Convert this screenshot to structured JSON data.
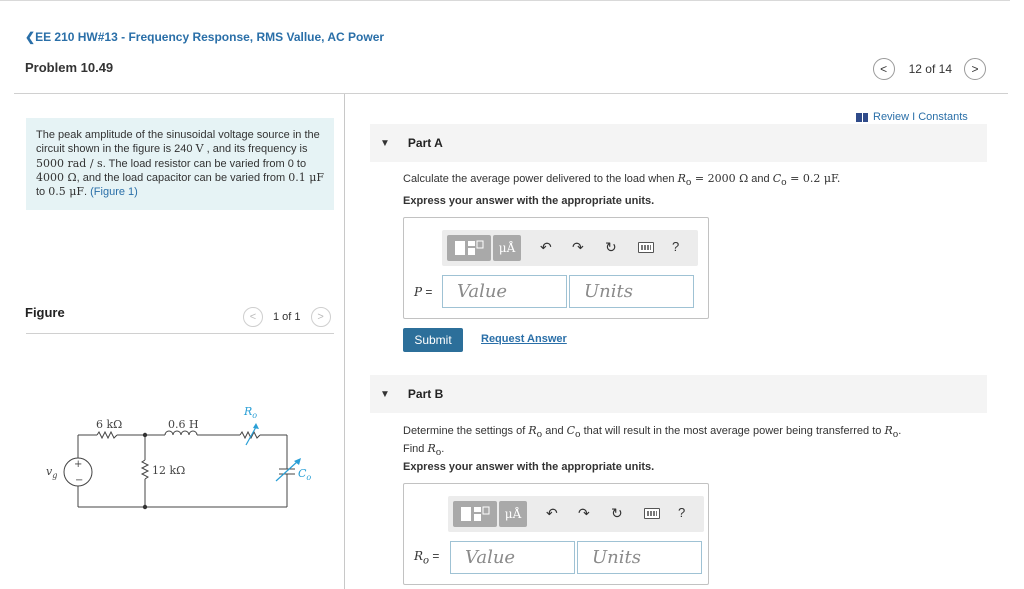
{
  "header": {
    "breadcrumb": "EE 210 HW#13 - Frequency Response, RMS Vallue, AC Power",
    "problem_title": "Problem 10.49",
    "pager_text": "12 of 14"
  },
  "problem": {
    "text_1": "The peak amplitude of the sinusoidal voltage source in the circuit shown in the figure is 240 ",
    "v_unit": "V",
    "text_2": " , and its frequency is ",
    "freq": "5000 rad / s",
    "text_3": ". The load resistor can be varied from 0 to ",
    "r_max": "4000 Ω",
    "text_4": ", and the load capacitor can be varied from ",
    "c_min": "0.1 μF",
    "to_word": " to ",
    "c_max": "0.5 μF",
    "text_5": ". ",
    "figure_link": "(Figure 1)"
  },
  "figure": {
    "label": "Figure",
    "pager_text": "1 of 1",
    "circuit": {
      "r1": "6 kΩ",
      "l1": "0.6 H",
      "ro": "R",
      "ro_sub": "o",
      "r2": "12 kΩ",
      "source": "v",
      "source_sub": "g",
      "co": "C",
      "co_sub": "o",
      "plus": "+",
      "minus": "−"
    }
  },
  "review": {
    "text": "Review I Constants"
  },
  "part_a": {
    "label": "Part A",
    "q_1": "Calculate the average power delivered to the load when ",
    "q_eq1": "R",
    "q_eq1_sub": "o",
    "q_eq1_val": " = 2000 Ω",
    "q_and": " and ",
    "q_eq2": "C",
    "q_eq2_sub": "o",
    "q_eq2_val": " = 0.2 μF",
    "q_end": ".",
    "instruction": "Express your answer with the appropriate units.",
    "var_label": "P",
    "var_eq": " =",
    "value_placeholder": "Value",
    "units_placeholder": "Units",
    "submit_label": "Submit",
    "request_label": "Request Answer"
  },
  "part_b": {
    "label": "Part B",
    "q_1": "Determine the settings of ",
    "q_r": "R",
    "q_r_sub": "o",
    "q_and": " and ",
    "q_c": "C",
    "q_c_sub": "o",
    "q_2": " that will result in the most average power being transferred to ",
    "q_r2": "R",
    "q_r2_sub": "o",
    "q_3": ".",
    "q_find": "Find ",
    "q_find_r": "R",
    "q_find_r_sub": "o",
    "q_find_end": ".",
    "instruction": "Express your answer with the appropriate units.",
    "var_label": "R",
    "var_sub": "o",
    "var_eq": " =",
    "value_placeholder": "Value",
    "units_placeholder": "Units"
  },
  "toolbar": {
    "mu_label": "μÅ",
    "undo": "↶",
    "redo": "↷",
    "reset": "↻",
    "help": "?"
  },
  "icons": {
    "back": "chevron-left-icon",
    "prev": "chevron-left-icon",
    "next": "chevron-right-icon",
    "collapse": "triangle-down-icon",
    "book": "book-icon",
    "keyboard": "keyboard-icon"
  },
  "colors": {
    "link": "#2a6fa8",
    "submit_bg": "#2c6f9a",
    "problem_bg": "#e6f3f5",
    "part_header_bg": "#f4f4f4",
    "circuit_accent": "#2a9fd6"
  }
}
